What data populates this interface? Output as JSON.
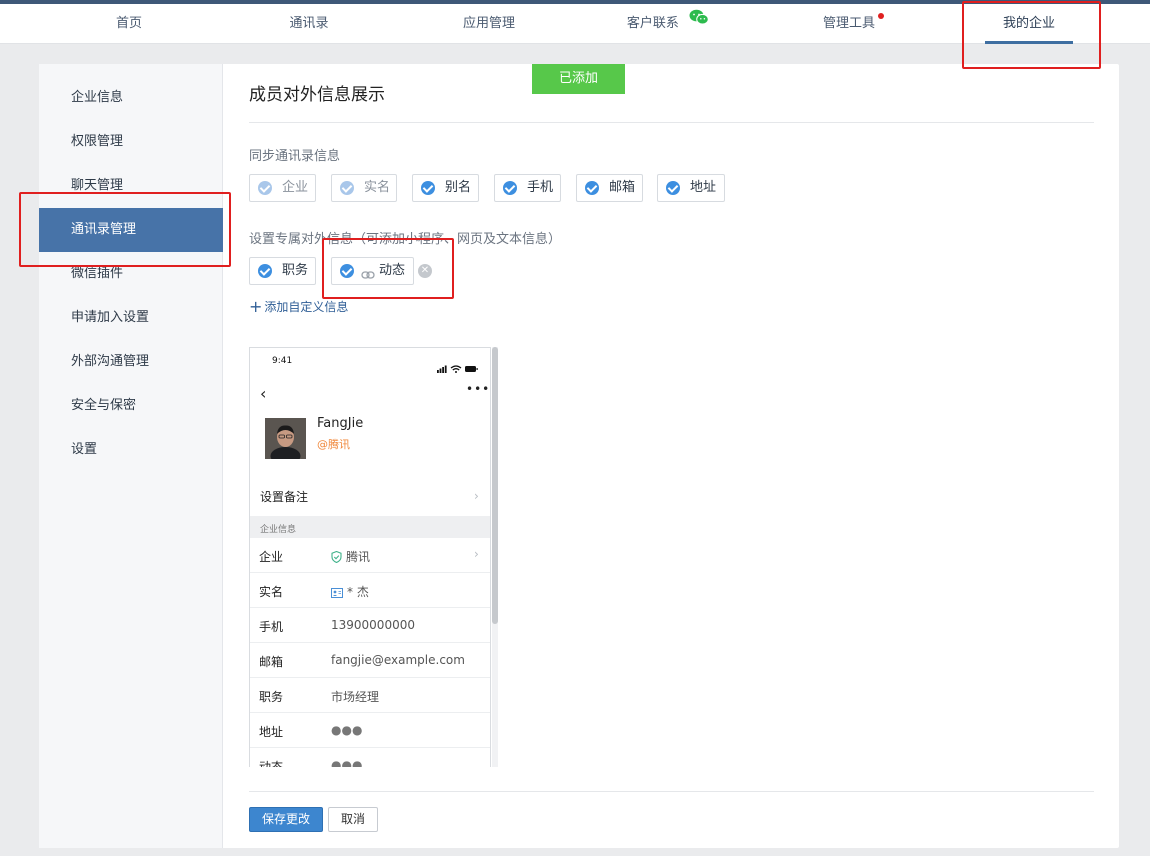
{
  "topnav": {
    "items": [
      {
        "label": "首页"
      },
      {
        "label": "通讯录"
      },
      {
        "label": "应用管理"
      },
      {
        "label": "客户联系"
      },
      {
        "label": "管理工具"
      },
      {
        "label": "我的企业"
      }
    ],
    "active": "我的企业"
  },
  "sidebar": {
    "items": [
      {
        "label": "企业信息"
      },
      {
        "label": "权限管理"
      },
      {
        "label": "聊天管理"
      },
      {
        "label": "通讯录管理"
      },
      {
        "label": "微信插件"
      },
      {
        "label": "申请加入设置"
      },
      {
        "label": "外部沟通管理"
      },
      {
        "label": "安全与保密"
      },
      {
        "label": "设置"
      }
    ],
    "active": "通讯录管理"
  },
  "main": {
    "title": "成员对外信息展示",
    "added_badge": "已添加",
    "sync_label": "同步通讯录信息",
    "sync_chips": [
      {
        "label": "企业",
        "disabled": true
      },
      {
        "label": "实名",
        "disabled": true
      },
      {
        "label": "别名",
        "disabled": false
      },
      {
        "label": "手机",
        "disabled": false
      },
      {
        "label": "邮箱",
        "disabled": false
      },
      {
        "label": "地址",
        "disabled": false
      }
    ],
    "custom_label": "设置专属对外信息（可添加小程序、网页及文本信息）",
    "custom_chips": [
      {
        "label": "职务"
      },
      {
        "label": "动态"
      }
    ],
    "add_custom": "添加自定义信息"
  },
  "preview": {
    "time": "9:41",
    "name": "FangJie",
    "corp": "@腾讯",
    "remark": "设置备注",
    "section": "企业信息",
    "rows": [
      {
        "key": "企业",
        "value": "腾讯"
      },
      {
        "key": "实名",
        "value": "* 杰"
      },
      {
        "key": "手机",
        "value": "13900000000"
      },
      {
        "key": "邮箱",
        "value": "fangjie@example.com"
      },
      {
        "key": "职务",
        "value": "市场经理"
      },
      {
        "key": "地址",
        "value": "●●●"
      },
      {
        "key": "动态",
        "value": "●●●"
      }
    ]
  },
  "footer": {
    "save": "保存更改",
    "cancel": "取消"
  },
  "colors": {
    "accent": "#4773a8",
    "success": "#57c84a",
    "highlight_box": "#e01f1f",
    "link": "#2f5e96"
  }
}
